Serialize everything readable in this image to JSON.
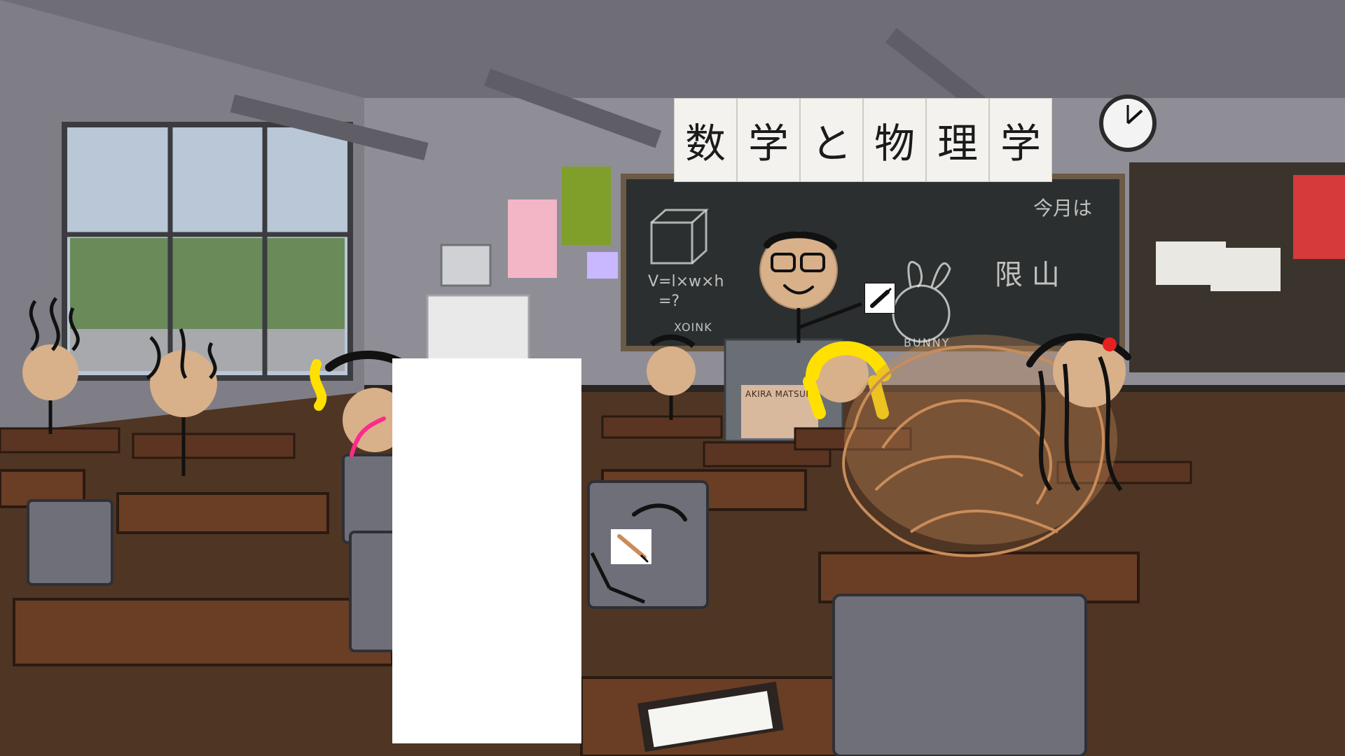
{
  "sign": {
    "chars": [
      "数",
      "学",
      "と",
      "物",
      "理",
      "学"
    ]
  },
  "chalkboard": {
    "formula_line1": "V=l×w×h",
    "formula_line2": "=?",
    "doodle_label_1": "XOINK",
    "doodle_label_2": "BUNNY",
    "top_right_text": "今月は",
    "right_text": "限 山"
  },
  "poster": {
    "akira_label": "AKIRA MATSUI"
  },
  "colors": {
    "wall": "#8b8a92",
    "ceiling": "#6f6d75",
    "board": "#2b2f30",
    "floor": "#5a3a24",
    "desk": "#5b3522",
    "chair": "#6e6f78",
    "skin": "#d8b08a",
    "hair_yellow": "#ffe000",
    "hair_black": "#111111",
    "hair_brown": "#c98c5a",
    "accent_red": "#e52020",
    "accent_pink": "#ff2a8a"
  },
  "icons": {
    "clock": "wall-clock-icon",
    "marker": "marker-icon",
    "pencil": "pencil-icon"
  }
}
